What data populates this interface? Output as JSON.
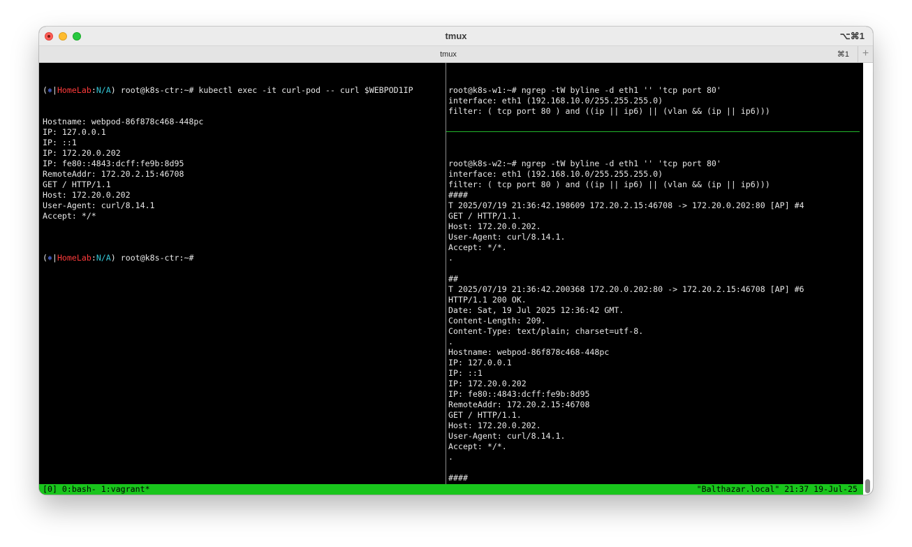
{
  "window": {
    "title": "tmux",
    "shortcut": "⌥⌘1"
  },
  "tab": {
    "label": "tmux",
    "shortcut": "⌘1",
    "new_tab_icon": "+"
  },
  "prompt_left": {
    "open": "(",
    "star": "⎈",
    "sep1": "|",
    "context": "HomeLab",
    "colon": ":",
    "namespace": "N/A",
    "close": ")",
    "host": " root@k8s-ctr:~# "
  },
  "left_pane": {
    "command": "kubectl exec -it curl-pod -- curl $WEBPOD1IP",
    "output": [
      "Hostname: webpod-86f878c468-448pc",
      "IP: 127.0.0.1",
      "IP: ::1",
      "IP: 172.20.0.202",
      "IP: fe80::4843:dcff:fe9b:8d95",
      "RemoteAddr: 172.20.2.15:46708",
      "GET / HTTP/1.1",
      "Host: 172.20.0.202",
      "User-Agent: curl/8.14.1",
      "Accept: */*",
      ""
    ],
    "second_prompt_cmd": ""
  },
  "right_top_pane": {
    "lines": [
      "root@k8s-w1:~# ngrep -tW byline -d eth1 '' 'tcp port 80'",
      "interface: eth1 (192.168.10.0/255.255.255.0)",
      "filter: ( tcp port 80 ) and ((ip || ip6) || (vlan && (ip || ip6)))"
    ]
  },
  "right_bottom_pane": {
    "lines": [
      "root@k8s-w2:~# ngrep -tW byline -d eth1 '' 'tcp port 80'",
      "interface: eth1 (192.168.10.0/255.255.255.0)",
      "filter: ( tcp port 80 ) and ((ip || ip6) || (vlan && (ip || ip6)))",
      "####",
      "T 2025/07/19 21:36:42.198609 172.20.2.15:46708 -> 172.20.0.202:80 [AP] #4",
      "GET / HTTP/1.1.",
      "Host: 172.20.0.202.",
      "User-Agent: curl/8.14.1.",
      "Accept: */*.",
      ".",
      "",
      "##",
      "T 2025/07/19 21:36:42.200368 172.20.0.202:80 -> 172.20.2.15:46708 [AP] #6",
      "HTTP/1.1 200 OK.",
      "Date: Sat, 19 Jul 2025 12:36:42 GMT.",
      "Content-Length: 209.",
      "Content-Type: text/plain; charset=utf-8.",
      ".",
      "Hostname: webpod-86f878c468-448pc",
      "IP: 127.0.0.1",
      "IP: ::1",
      "IP: 172.20.0.202",
      "IP: fe80::4843:dcff:fe9b:8d95",
      "RemoteAddr: 172.20.2.15:46708",
      "GET / HTTP/1.1.",
      "Host: 172.20.0.202.",
      "User-Agent: curl/8.14.1.",
      "Accept: */*.",
      ".",
      "",
      "####"
    ]
  },
  "status_bar": {
    "left": "[0] 0:bash- 1:vagrant*",
    "right": "\"Balthazar.local\" 21:37 19-Jul-25"
  },
  "colors": {
    "status_green": "#19c51c",
    "divider_green": "#22b82c",
    "context_red": "#ff3b3b",
    "namespace_cyan": "#33c6d6",
    "k8s_blue": "#5b7cff"
  }
}
